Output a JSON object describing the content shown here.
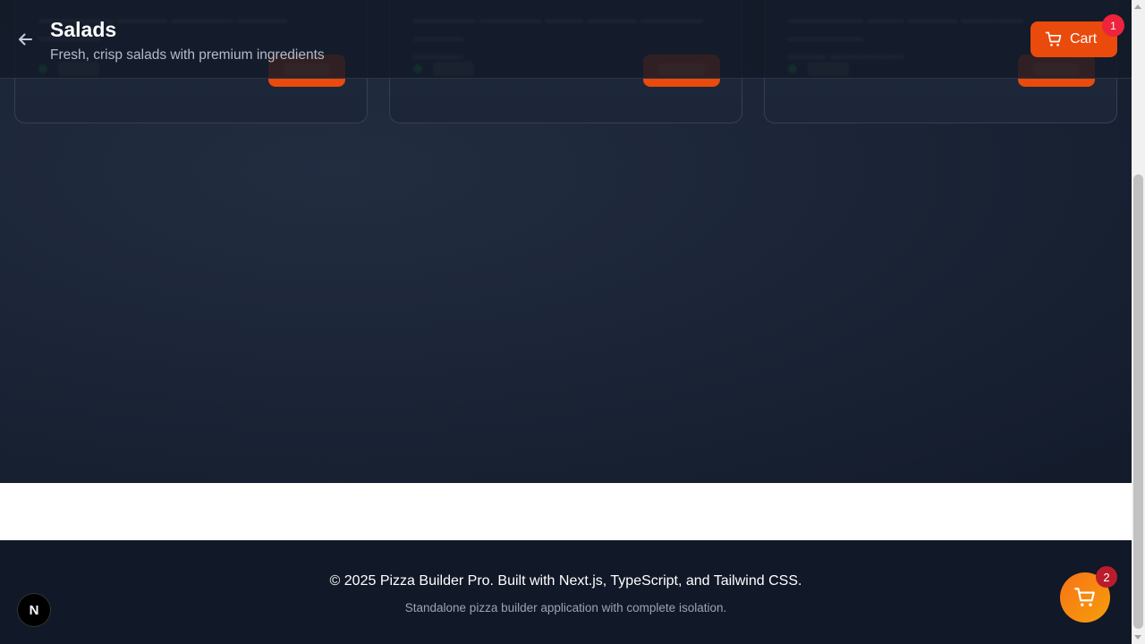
{
  "header": {
    "title": "Salads",
    "subtitle": "Fresh, crisp salads with premium ingredients",
    "cart_label": "Cart",
    "cart_count": "1"
  },
  "colors": {
    "accent": "#ea4a0c",
    "badge": "#ef233c",
    "fab": "#f59e0b",
    "footer_bg": "#111827"
  },
  "footer": {
    "copyright": "© 2025 Pizza Builder Pro. Built with Next.js, TypeScript, and Tailwind CSS.",
    "tagline": "Standalone pizza builder application with complete isolation."
  },
  "floating_cart": {
    "icon": "cart-icon",
    "count": "2"
  },
  "dev_badge": {
    "label": "N"
  },
  "icons": {
    "back": "arrow-left-icon",
    "cart": "cart-icon"
  }
}
